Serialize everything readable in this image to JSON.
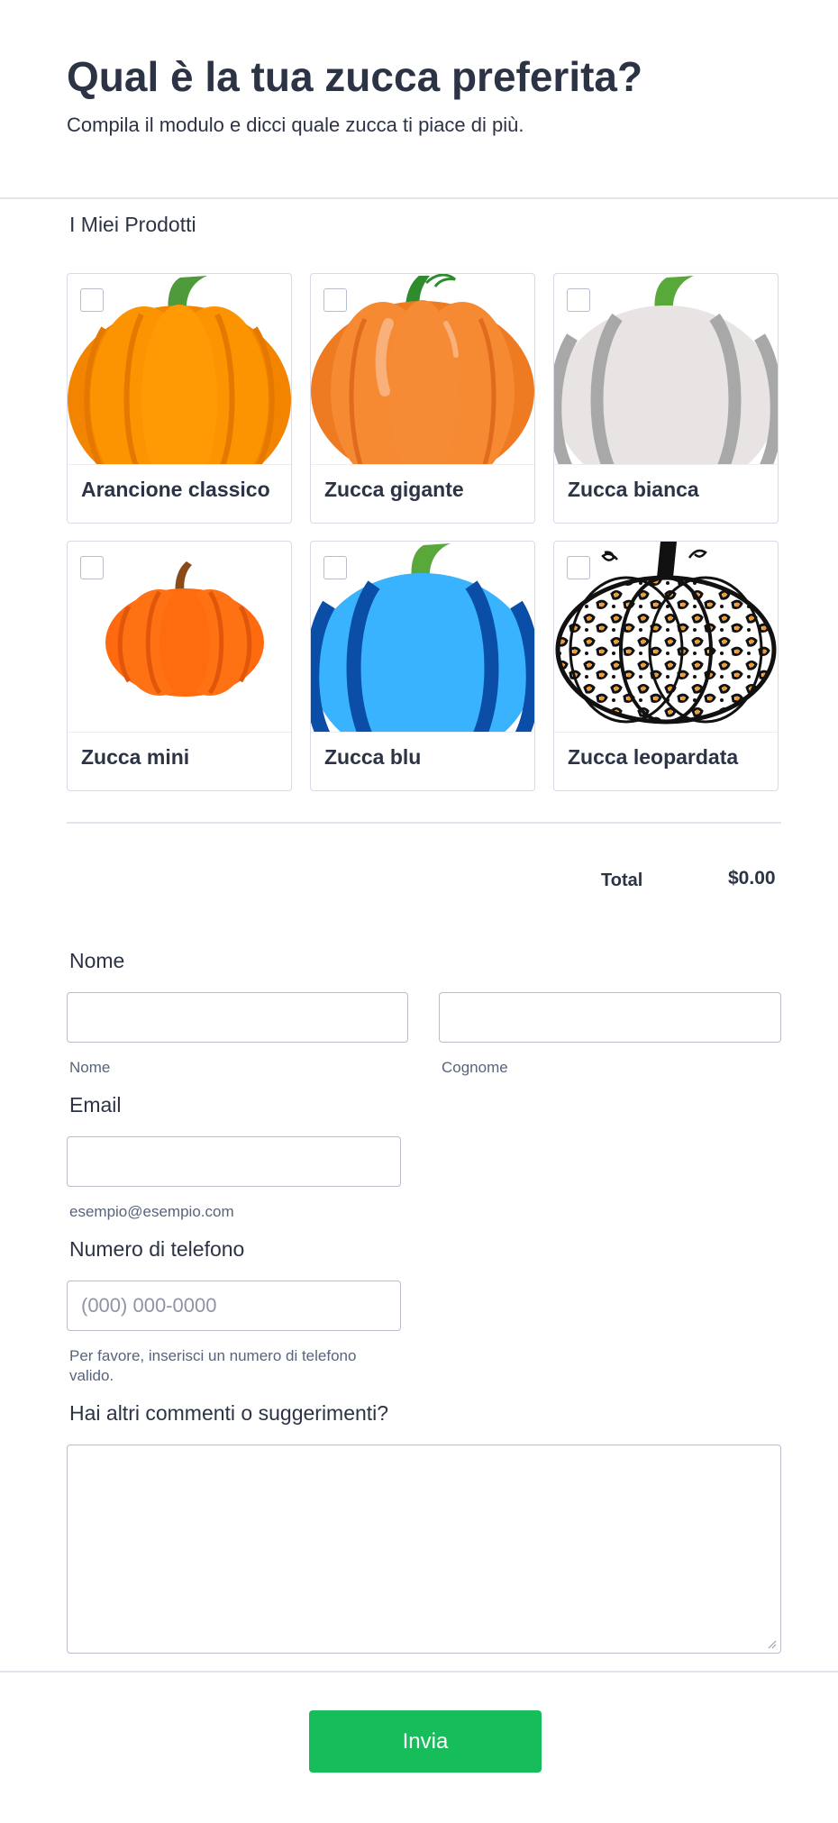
{
  "header": {
    "title": "Qual è la tua zucca preferita?",
    "subtitle": "Compila il modulo e dicci quale zucca ti piace di più."
  },
  "products": {
    "label": "I Miei Prodotti",
    "items": [
      {
        "name": "Arancione classico",
        "image": "classic-orange-pumpkin-icon"
      },
      {
        "name": "Zucca gigante",
        "image": "giant-pumpkin-icon"
      },
      {
        "name": "Zucca bianca",
        "image": "white-pumpkin-icon"
      },
      {
        "name": "Zucca mini",
        "image": "mini-pumpkin-icon"
      },
      {
        "name": "Zucca blu",
        "image": "blue-pumpkin-icon"
      },
      {
        "name": "Zucca leopardata",
        "image": "leopard-pumpkin-icon"
      }
    ]
  },
  "total": {
    "label": "Total",
    "value": "$0.00"
  },
  "form": {
    "name": {
      "label": "Nome",
      "first_sublabel": "Nome",
      "last_sublabel": "Cognome"
    },
    "email": {
      "label": "Email",
      "sublabel": "esempio@esempio.com"
    },
    "phone": {
      "label": "Numero di telefono",
      "placeholder": "(000) 000-0000",
      "sublabel": "Per favore, inserisci un numero di telefono valido."
    },
    "comments": {
      "label": "Hai altri commenti o suggerimenti?"
    },
    "submit_label": "Invia"
  },
  "colors": {
    "accent": "#18bd5b",
    "text": "#2c3345",
    "border": "#b8bdc9"
  }
}
